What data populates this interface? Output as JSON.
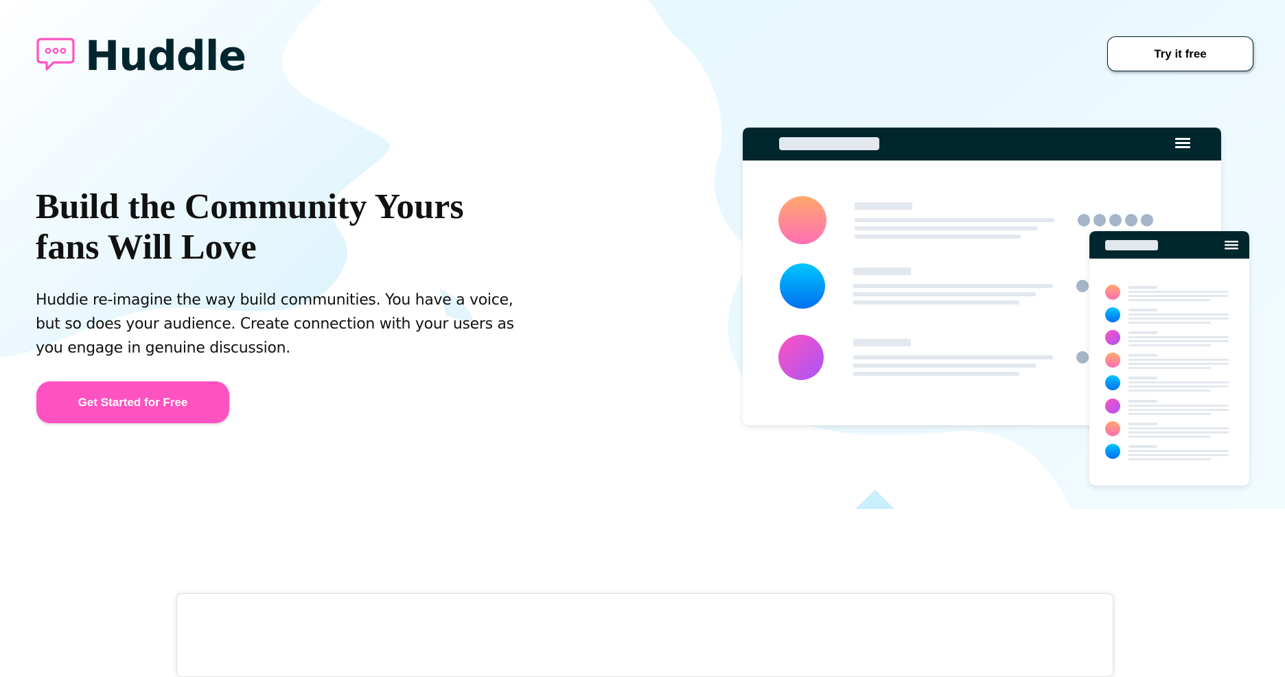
{
  "brand": {
    "name": "Huddle",
    "logo_icon": "chat-bubble-icon",
    "accent": "#ff52c1",
    "dark": "#00252e"
  },
  "nav": {
    "try_label": "Try it free"
  },
  "hero": {
    "headline_line1": "Build the Community Yours",
    "headline_line2": "fans Will Love",
    "intro_line1": "Huddie re-imagine the way build communities. You have a voice,",
    "intro_line2": "but so does your audience. Create connection with your users as",
    "intro_line3": "you engage in genuine discussion.",
    "cta_label": "Get Started for Free"
  },
  "illustration": {
    "main_menu_icon": "hamburger-menu-icon",
    "mobile_menu_icon": "hamburger-menu-icon",
    "gradients": {
      "peach": [
        "#ff9a7b",
        "#ff7fb0"
      ],
      "blue": [
        "#00c6ff",
        "#0077ff"
      ],
      "purple": [
        "#ff52c1",
        "#a855f7"
      ]
    }
  }
}
